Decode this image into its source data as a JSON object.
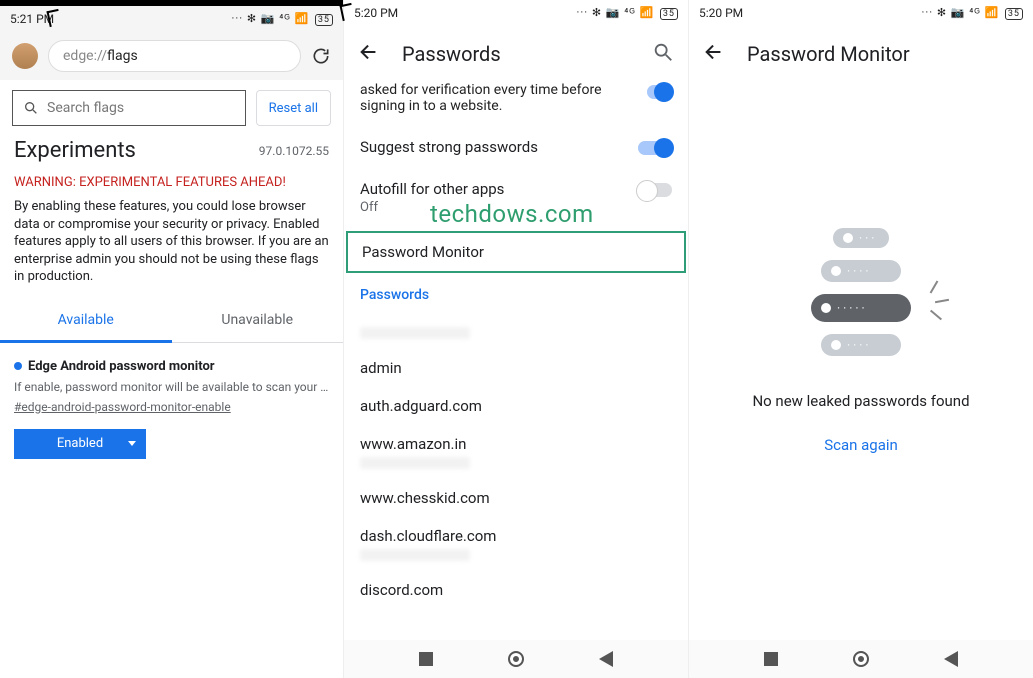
{
  "col1": {
    "status_time": "5:21 PM",
    "status_icons": "··· ✻ 📷 ⁴ᴳ 📶",
    "status_batt": "35",
    "addr_prefix": "edge://",
    "addr_suffix": "flags",
    "search_placeholder": "Search flags",
    "reset": "Reset all",
    "experiments": "Experiments",
    "version": "97.0.1072.55",
    "warning": "WARNING: EXPERIMENTAL FEATURES AHEAD!",
    "body": "By enabling these features, you could lose browser data or compromise your security or privacy. Enabled features apply to all users of this browser. If you are an enterprise admin you should not be using these flags in production.",
    "tab_available": "Available",
    "tab_unavailable": "Unavailable",
    "flag": {
      "title": "Edge Android password monitor",
      "desc": "If enable, password monitor will be available to scan your …",
      "link": "#edge-android-password-monitor-enable",
      "dropdown": "Enabled"
    }
  },
  "col2": {
    "status_time": "5:20 PM",
    "status_icons": "··· ✻ 📷 ⁴ᴳ 📶",
    "status_batt": "35",
    "title": "Passwords",
    "top_text": "asked for verification every time before signing in to a website.",
    "suggest": "Suggest strong passwords",
    "autofill": "Autofill for other apps",
    "autofill_sub": "Off",
    "pm_highlight": "Password Monitor",
    "pw_header": "Passwords",
    "sites": [
      "admin",
      "auth.adguard.com",
      "www.amazon.in",
      "www.chesskid.com",
      "dash.cloudflare.com",
      "discord.com"
    ]
  },
  "col3": {
    "status_time": "5:20 PM",
    "status_icons": "··· ✻ 📷 ⁴ᴳ 📶",
    "status_batt": "35",
    "title": "Password Monitor",
    "no_leak": "No new leaked passwords found",
    "scan": "Scan again"
  },
  "watermark": "techdows.com"
}
